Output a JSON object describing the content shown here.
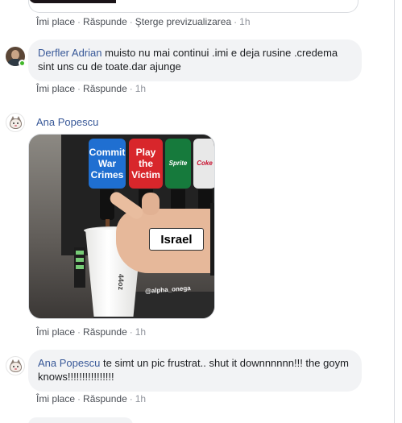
{
  "top_comment": {
    "actions": {
      "like": "Îmi place",
      "reply": "Răspunde",
      "remove_preview": "Şterge previzualizarea",
      "time": "1h"
    }
  },
  "comments": [
    {
      "author": "Derfler Adrian",
      "text": "muisto nu mai continui .imi e deja rusine .credema sint uns cu de toate.dar ajunge",
      "actions": {
        "like": "Îmi place",
        "reply": "Răspunde",
        "time": "1h"
      }
    },
    {
      "author": "Ana Popescu",
      "image": {
        "taps": [
          "Commit War Crimes",
          "Play the Victim",
          "Sprite",
          "Coke"
        ],
        "hand_label": "Israel",
        "cup_text": "44oz",
        "watermark": "@alpha_onega"
      },
      "actions": {
        "like": "Îmi place",
        "reply": "Răspunde",
        "time": "1h"
      }
    },
    {
      "author": "Ana Popescu",
      "text": "te simt un pic frustrat.. shut it downnnnnn!!! the goym knows!!!!!!!!!!!!!!!!",
      "actions": {
        "like": "Îmi place",
        "reply": "Răspunde",
        "time": "1h"
      }
    }
  ],
  "separator": "·"
}
